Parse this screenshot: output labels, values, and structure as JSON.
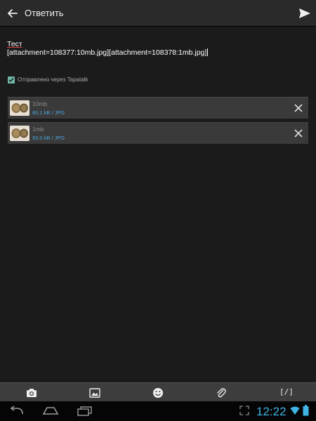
{
  "actionbar": {
    "title": "Ответить"
  },
  "editor": {
    "line1": "Тест",
    "line2": "[attachment=108377:10mb.jpg][attachment=108378:1mb.jpg]"
  },
  "signature": {
    "label": "Отправлено через Tapatalk",
    "checked": true
  },
  "attachments": [
    {
      "name": "10mb",
      "meta": "80,1 kB / JPG"
    },
    {
      "name": "1mb",
      "meta": "93,0 kB / JPG"
    }
  ],
  "toolbar": {
    "code_label": "[/]"
  },
  "statusbar": {
    "time": "12:22"
  },
  "colors": {
    "accent": "#4aa6d9",
    "checkbox": "#6fb7a8",
    "clock": "#3fb4e5",
    "background": "#1b1b1b"
  }
}
